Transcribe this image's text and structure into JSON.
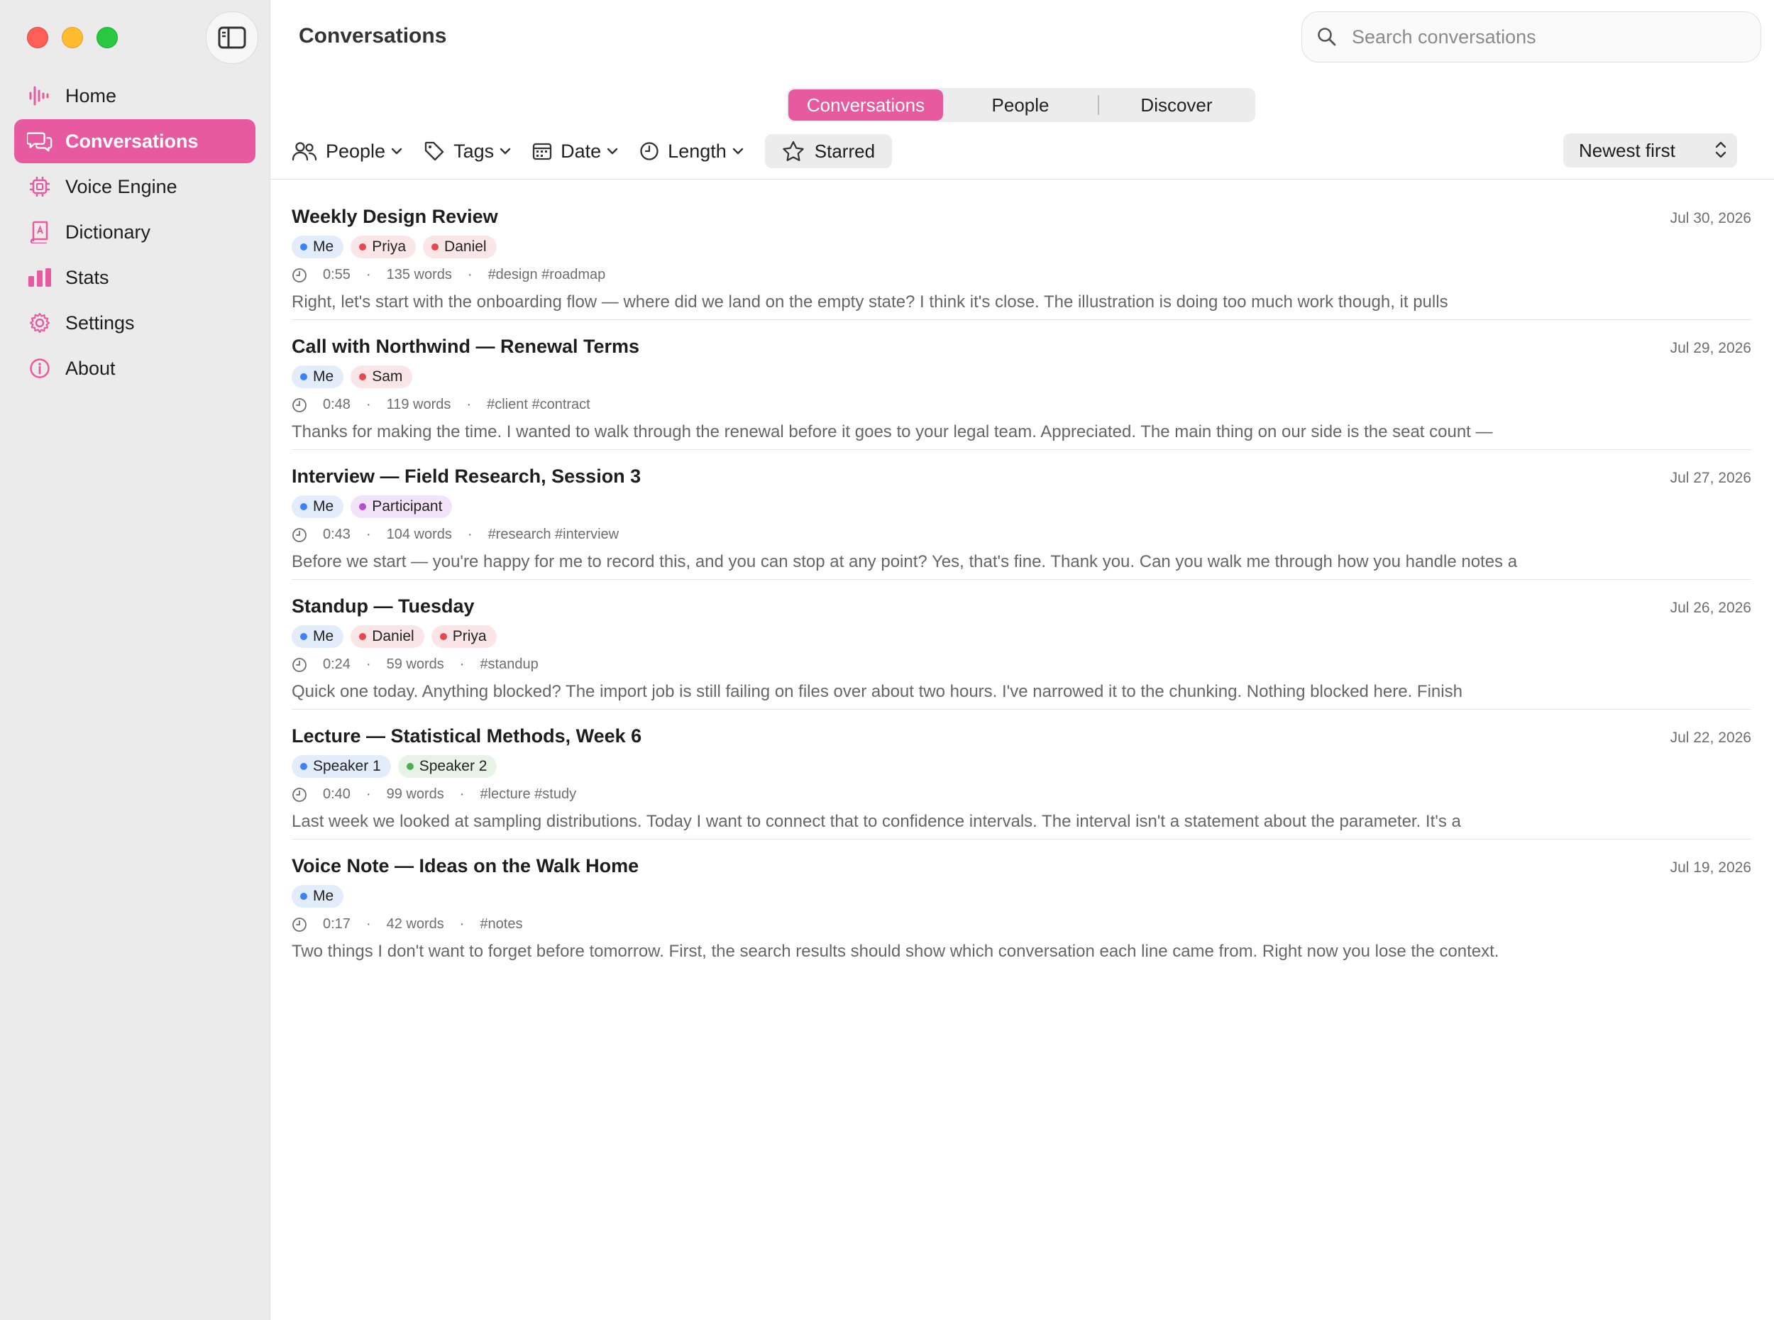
{
  "colors": {
    "accent": "#e85aa0",
    "dot_blue": "#3b82f6",
    "dot_red": "#e5484d",
    "dot_purple": "#b34fd6",
    "dot_green": "#4caf50"
  },
  "sidebar": {
    "items": [
      {
        "label": "Home",
        "icon": "waveform-icon",
        "active": false
      },
      {
        "label": "Conversations",
        "icon": "chat-bubbles-icon",
        "active": true
      },
      {
        "label": "Voice Engine",
        "icon": "chip-icon",
        "active": false
      },
      {
        "label": "Dictionary",
        "icon": "book-icon",
        "active": false
      },
      {
        "label": "Stats",
        "icon": "bar-chart-icon",
        "active": false
      },
      {
        "label": "Settings",
        "icon": "gear-icon",
        "active": false
      },
      {
        "label": "About",
        "icon": "info-icon",
        "active": false
      }
    ]
  },
  "header": {
    "title": "Conversations",
    "search_placeholder": "Search conversations"
  },
  "segments": [
    {
      "label": "Conversations",
      "active": true
    },
    {
      "label": "People",
      "active": false
    },
    {
      "label": "Discover",
      "active": false
    }
  ],
  "filters": {
    "people": "People",
    "tags": "Tags",
    "date": "Date",
    "length": "Length",
    "starred": "Starred",
    "sort": "Newest first"
  },
  "conversations": [
    {
      "title": "Weekly Design Review",
      "date": "Jul 30, 2026",
      "participants": [
        {
          "name": "Me",
          "color": "blue"
        },
        {
          "name": "Priya",
          "color": "red"
        },
        {
          "name": "Daniel",
          "color": "red"
        }
      ],
      "duration": "0:55",
      "words": "135 words",
      "tags": "#design #roadmap",
      "preview": "Right, let's start with the onboarding flow — where did we land on the empty state? I think it's close. The illustration is doing too much work though, it pulls"
    },
    {
      "title": "Call with Northwind — Renewal Terms",
      "date": "Jul 29, 2026",
      "participants": [
        {
          "name": "Me",
          "color": "blue"
        },
        {
          "name": "Sam",
          "color": "red"
        }
      ],
      "duration": "0:48",
      "words": "119 words",
      "tags": "#client #contract",
      "preview": "Thanks for making the time. I wanted to walk through the renewal before it goes to your legal team. Appreciated. The main thing on our side is the seat count —"
    },
    {
      "title": "Interview — Field Research, Session 3",
      "date": "Jul 27, 2026",
      "participants": [
        {
          "name": "Me",
          "color": "blue"
        },
        {
          "name": "Participant",
          "color": "purple"
        }
      ],
      "duration": "0:43",
      "words": "104 words",
      "tags": "#research #interview",
      "preview": "Before we start — you're happy for me to record this, and you can stop at any point? Yes, that's fine. Thank you. Can you walk me through how you handle notes a"
    },
    {
      "title": "Standup — Tuesday",
      "date": "Jul 26, 2026",
      "participants": [
        {
          "name": "Me",
          "color": "blue"
        },
        {
          "name": "Daniel",
          "color": "red"
        },
        {
          "name": "Priya",
          "color": "red"
        }
      ],
      "duration": "0:24",
      "words": "59 words",
      "tags": "#standup",
      "preview": "Quick one today. Anything blocked? The import job is still failing on files over about two hours. I've narrowed it to the chunking. Nothing blocked here. Finish"
    },
    {
      "title": "Lecture — Statistical Methods, Week 6",
      "date": "Jul 22, 2026",
      "participants": [
        {
          "name": "Speaker 1",
          "color": "blue"
        },
        {
          "name": "Speaker 2",
          "color": "green"
        }
      ],
      "duration": "0:40",
      "words": "99 words",
      "tags": "#lecture #study",
      "preview": "Last week we looked at sampling distributions. Today I want to connect that to confidence intervals. The interval isn't a statement about the parameter. It's a"
    },
    {
      "title": "Voice Note — Ideas on the Walk Home",
      "date": "Jul 19, 2026",
      "participants": [
        {
          "name": "Me",
          "color": "blue"
        }
      ],
      "duration": "0:17",
      "words": "42 words",
      "tags": "#notes",
      "preview": "Two things I don't want to forget before tomorrow. First, the search results should show which conversation each line came from. Right now you lose the context."
    }
  ]
}
